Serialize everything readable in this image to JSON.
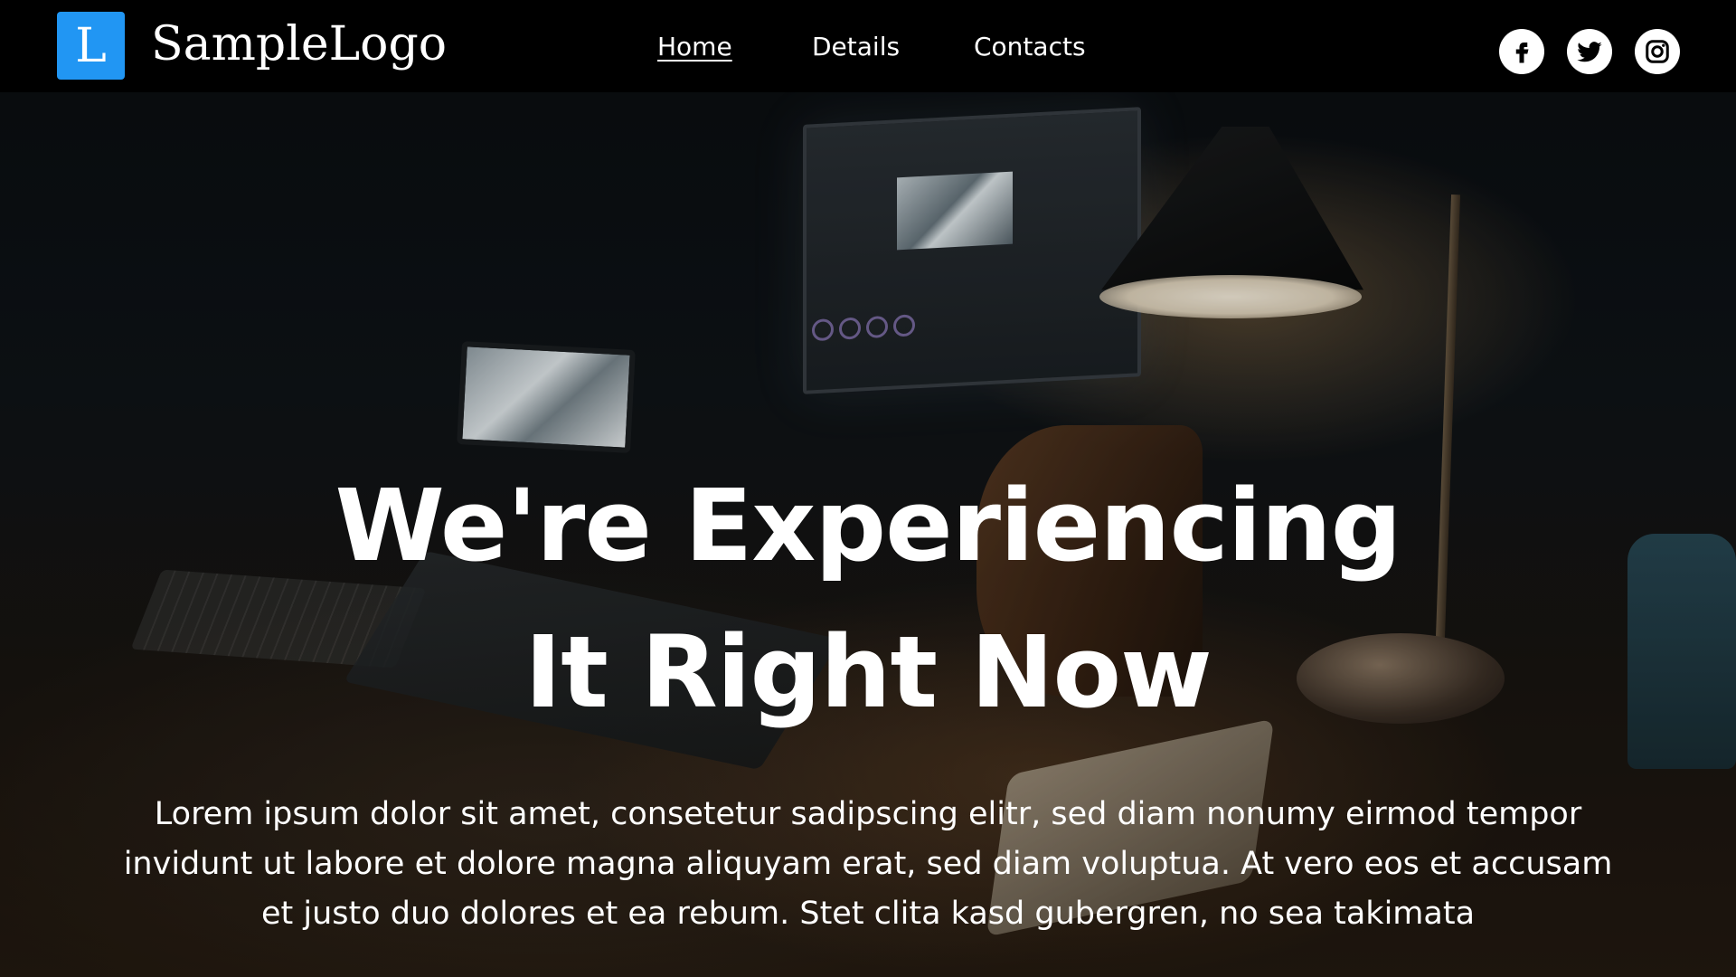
{
  "brand": {
    "logo_letter": "L",
    "logo_text": "SampleLogo",
    "accent_color": "#2196f3"
  },
  "nav": {
    "items": [
      {
        "label": "Home",
        "active": true
      },
      {
        "label": "Details",
        "active": false
      },
      {
        "label": "Contacts",
        "active": false
      }
    ]
  },
  "social": [
    {
      "icon": "facebook-icon"
    },
    {
      "icon": "twitter-icon"
    },
    {
      "icon": "instagram-icon"
    }
  ],
  "hero": {
    "title_line1": "We're Experiencing",
    "title_line2": "It Right Now",
    "body": "Lorem ipsum dolor sit amet, consetetur sadipscing elitr, sed diam nonumy eirmod tempor invidunt ut labore et dolore magna aliquyam erat, sed diam voluptua. At vero eos et accusam et justo duo dolores et ea rebum. Stet clita kasd gubergren, no sea takimata"
  }
}
